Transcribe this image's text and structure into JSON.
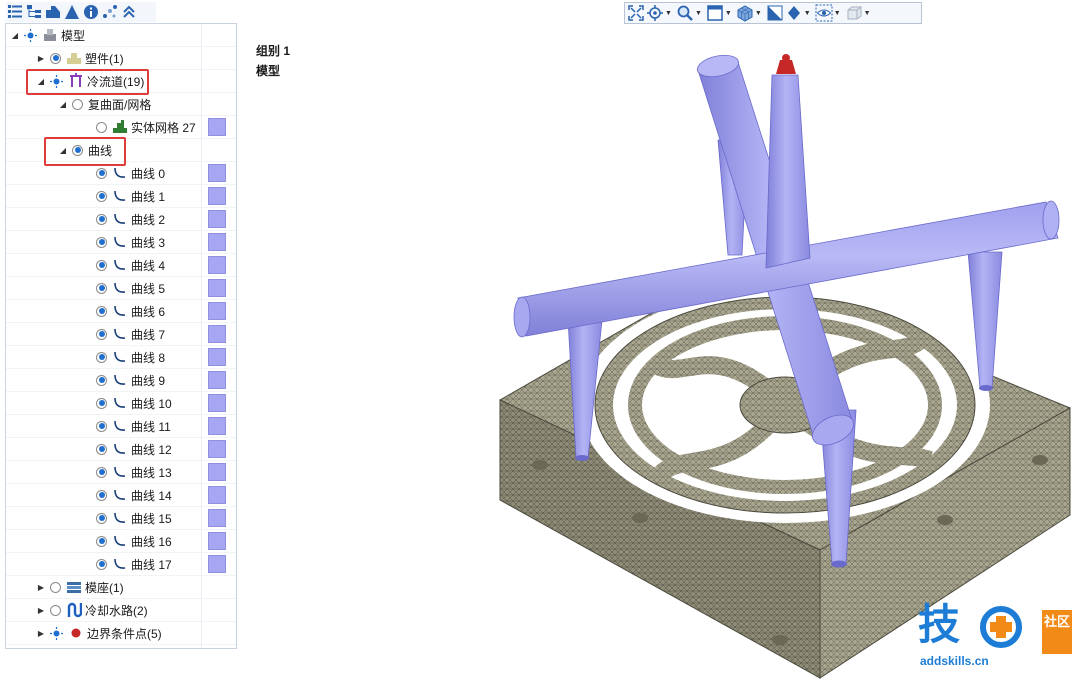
{
  "toolbar_left": {
    "icons": [
      "tree-list-icon",
      "tree-hierarchy-icon",
      "part-icon",
      "mesh-cone-icon",
      "info-icon",
      "points-icon",
      "collapse-icon"
    ]
  },
  "tree": {
    "model": "模型",
    "part": "塑件(1)",
    "cooling_channel": "冷流道(19)",
    "compound_surface": "复曲面/网格",
    "solid_mesh": "实体网格 27",
    "curves_group": "曲线",
    "curves": [
      "曲线 0",
      "曲线 1",
      "曲线 2",
      "曲线 3",
      "曲线 4",
      "曲线 5",
      "曲线 6",
      "曲线 7",
      "曲线 8",
      "曲线 9",
      "曲线 10",
      "曲线 11",
      "曲线 12",
      "曲线 13",
      "曲线 14",
      "曲线 15",
      "曲线 16",
      "曲线 17"
    ],
    "mold_base": "模座(1)",
    "cooling_water": "冷却水路(2)",
    "boundary_points": "边界条件点(5)"
  },
  "view_toolbar": {
    "icons": [
      "fit-view-icon",
      "view-center-icon",
      "zoom-icon",
      "window-icon",
      "mesh-cube-icon",
      "shaded-icon",
      "render-mode-icon",
      "visibility-eye-icon",
      "box-icon"
    ]
  },
  "viewport": {
    "group_label": "组别 1",
    "model_label": "模型"
  },
  "watermark": {
    "logo_text": "技",
    "badge_text": "社区",
    "url": "addskills.cn"
  },
  "colors": {
    "channel": "#a4a4ee",
    "mesh": "#a9a68f",
    "highlight": "#e03b3b",
    "swatch": "#a6a6f2"
  }
}
